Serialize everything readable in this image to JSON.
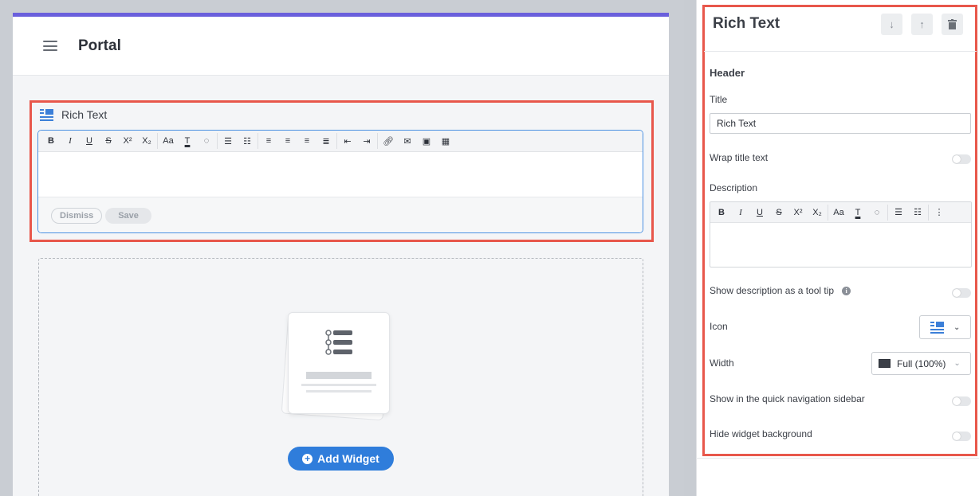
{
  "portal": {
    "title": "Portal"
  },
  "widget": {
    "name": "Rich Text",
    "dismiss": "Dismiss",
    "save": "Save",
    "add_widget": "Add Widget",
    "icon": "rich-text-icon"
  },
  "toolbar": {
    "bold": "B",
    "italic": "I",
    "underline": "U",
    "strike": "S",
    "sup": "X²",
    "sub": "X₂",
    "fontsize": "Aa",
    "textcolor": "T"
  },
  "panel": {
    "title": "Rich Text",
    "section": "Header",
    "title_label": "Title",
    "title_value": "Rich Text",
    "wrap_label": "Wrap title text",
    "desc_label": "Description",
    "tooltip_label": "Show description as a tool tip",
    "icon_label": "Icon",
    "width_label": "Width",
    "width_value": "Full (100%)",
    "quicknav_label": "Show in the quick navigation sidebar",
    "hidebg_label": "Hide widget background"
  },
  "colors": {
    "accent": "#6a5fdc",
    "highlight": "#e8574b",
    "primary": "#2f7ddb"
  }
}
